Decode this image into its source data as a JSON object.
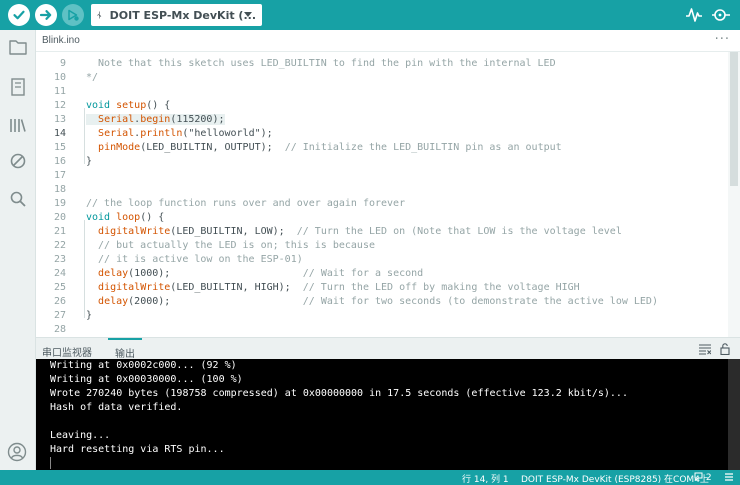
{
  "toolbar": {
    "board_label": "DOIT ESP-Mx DevKit (...",
    "verify_icon": "check-icon",
    "upload_icon": "arrow-right-icon",
    "debug_icon": "debug-icon",
    "serial_plotter_icon": "pulse-icon",
    "serial_monitor_icon": "magnifier-dot-icon"
  },
  "tabs": {
    "file_name": "Blink.ino",
    "more": "···"
  },
  "editor": {
    "lines": [
      {
        "num": "9",
        "text": "  Note that this sketch uses LED_BUILTIN to find the pin with the internal LED"
      },
      {
        "num": "10",
        "text": "*/"
      },
      {
        "num": "11",
        "text": ""
      },
      {
        "num": "12",
        "text": "void setup() {"
      },
      {
        "num": "13",
        "text": "  Serial.begin(115200);"
      },
      {
        "num": "14",
        "text": "  Serial.println(\"helloworld\");"
      },
      {
        "num": "15",
        "text": "  pinMode(LED_BUILTIN, OUTPUT);  // Initialize the LED_BUILTIN pin as an output"
      },
      {
        "num": "16",
        "text": "}"
      },
      {
        "num": "17",
        "text": ""
      },
      {
        "num": "18",
        "text": ""
      },
      {
        "num": "19",
        "text": "// the loop function runs over and over again forever"
      },
      {
        "num": "20",
        "text": "void loop() {"
      },
      {
        "num": "21",
        "text": "  digitalWrite(LED_BUILTIN, LOW);  // Turn the LED on (Note that LOW is the voltage level"
      },
      {
        "num": "22",
        "text": "  // but actually the LED is on; this is because"
      },
      {
        "num": "23",
        "text": "  // it is active low on the ESP-01)"
      },
      {
        "num": "24",
        "text": "  delay(1000);                      // Wait for a second"
      },
      {
        "num": "25",
        "text": "  digitalWrite(LED_BUILTIN, HIGH);  // Turn the LED off by making the voltage HIGH"
      },
      {
        "num": "26",
        "text": "  delay(2000);                      // Wait for two seconds (to demonstrate the active low LED)"
      },
      {
        "num": "27",
        "text": "}"
      },
      {
        "num": "28",
        "text": ""
      }
    ]
  },
  "panel": {
    "tab_serial_monitor": "串口监视器",
    "tab_output": "输出",
    "output_lines": [
      "Writing at 0x0002c000... (92 %)",
      "Writing at 0x00030000... (100 %)",
      "Wrote 270240 bytes (198758 compressed) at 0x00000000 in 17.5 seconds (effective 123.2 kbit/s)...",
      "Hash of data verified.",
      "",
      "Leaving...",
      "Hard resetting via RTS pin..."
    ]
  },
  "status": {
    "position": "行 14, 列 1",
    "board_port": "DOIT ESP-Mx DevKit (ESP8285) 在COM4上",
    "notifications": "2"
  },
  "colors": {
    "accent": "#17a1a5",
    "keyword": "#00979c",
    "function": "#d35400",
    "comment": "#95a5a6"
  }
}
